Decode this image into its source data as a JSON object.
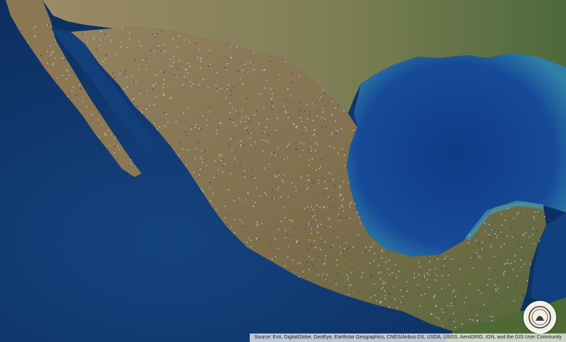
{
  "map": {
    "type": "satellite-basemap-with-point-overlay",
    "region": "Mexico",
    "basemap": "imagery",
    "overlay_color": "#a9d4ea",
    "overlay_dark_color": "#1f3f9a",
    "land_color": "#8a7a55",
    "vegetation_color": "#4f6a35",
    "ocean_color": "#123e78"
  },
  "attribution": {
    "text": "Source: Esri, DigitalGlobe, GeoEye, Earthstar Geographics, CNES/Airbus DS, USDA, USGS, AeroGRID, IGN, and the GIS User Community"
  },
  "logo": {
    "icon": "institution-seal-icon"
  }
}
